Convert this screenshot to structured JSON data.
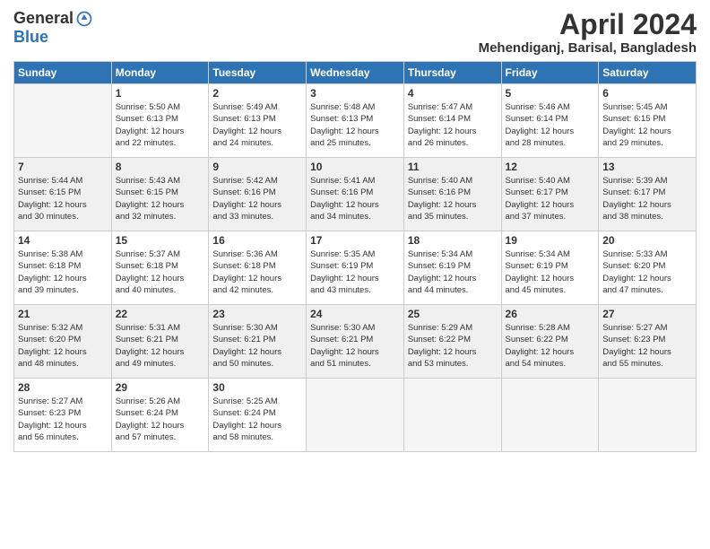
{
  "header": {
    "logo_general": "General",
    "logo_blue": "Blue",
    "month_title": "April 2024",
    "location": "Mehendiganj, Barisal, Bangladesh"
  },
  "days_of_week": [
    "Sunday",
    "Monday",
    "Tuesday",
    "Wednesday",
    "Thursday",
    "Friday",
    "Saturday"
  ],
  "weeks": [
    [
      {
        "day": "",
        "info": ""
      },
      {
        "day": "1",
        "info": "Sunrise: 5:50 AM\nSunset: 6:13 PM\nDaylight: 12 hours\nand 22 minutes."
      },
      {
        "day": "2",
        "info": "Sunrise: 5:49 AM\nSunset: 6:13 PM\nDaylight: 12 hours\nand 24 minutes."
      },
      {
        "day": "3",
        "info": "Sunrise: 5:48 AM\nSunset: 6:13 PM\nDaylight: 12 hours\nand 25 minutes."
      },
      {
        "day": "4",
        "info": "Sunrise: 5:47 AM\nSunset: 6:14 PM\nDaylight: 12 hours\nand 26 minutes."
      },
      {
        "day": "5",
        "info": "Sunrise: 5:46 AM\nSunset: 6:14 PM\nDaylight: 12 hours\nand 28 minutes."
      },
      {
        "day": "6",
        "info": "Sunrise: 5:45 AM\nSunset: 6:15 PM\nDaylight: 12 hours\nand 29 minutes."
      }
    ],
    [
      {
        "day": "7",
        "info": "Sunrise: 5:44 AM\nSunset: 6:15 PM\nDaylight: 12 hours\nand 30 minutes."
      },
      {
        "day": "8",
        "info": "Sunrise: 5:43 AM\nSunset: 6:15 PM\nDaylight: 12 hours\nand 32 minutes."
      },
      {
        "day": "9",
        "info": "Sunrise: 5:42 AM\nSunset: 6:16 PM\nDaylight: 12 hours\nand 33 minutes."
      },
      {
        "day": "10",
        "info": "Sunrise: 5:41 AM\nSunset: 6:16 PM\nDaylight: 12 hours\nand 34 minutes."
      },
      {
        "day": "11",
        "info": "Sunrise: 5:40 AM\nSunset: 6:16 PM\nDaylight: 12 hours\nand 35 minutes."
      },
      {
        "day": "12",
        "info": "Sunrise: 5:40 AM\nSunset: 6:17 PM\nDaylight: 12 hours\nand 37 minutes."
      },
      {
        "day": "13",
        "info": "Sunrise: 5:39 AM\nSunset: 6:17 PM\nDaylight: 12 hours\nand 38 minutes."
      }
    ],
    [
      {
        "day": "14",
        "info": "Sunrise: 5:38 AM\nSunset: 6:18 PM\nDaylight: 12 hours\nand 39 minutes."
      },
      {
        "day": "15",
        "info": "Sunrise: 5:37 AM\nSunset: 6:18 PM\nDaylight: 12 hours\nand 40 minutes."
      },
      {
        "day": "16",
        "info": "Sunrise: 5:36 AM\nSunset: 6:18 PM\nDaylight: 12 hours\nand 42 minutes."
      },
      {
        "day": "17",
        "info": "Sunrise: 5:35 AM\nSunset: 6:19 PM\nDaylight: 12 hours\nand 43 minutes."
      },
      {
        "day": "18",
        "info": "Sunrise: 5:34 AM\nSunset: 6:19 PM\nDaylight: 12 hours\nand 44 minutes."
      },
      {
        "day": "19",
        "info": "Sunrise: 5:34 AM\nSunset: 6:19 PM\nDaylight: 12 hours\nand 45 minutes."
      },
      {
        "day": "20",
        "info": "Sunrise: 5:33 AM\nSunset: 6:20 PM\nDaylight: 12 hours\nand 47 minutes."
      }
    ],
    [
      {
        "day": "21",
        "info": "Sunrise: 5:32 AM\nSunset: 6:20 PM\nDaylight: 12 hours\nand 48 minutes."
      },
      {
        "day": "22",
        "info": "Sunrise: 5:31 AM\nSunset: 6:21 PM\nDaylight: 12 hours\nand 49 minutes."
      },
      {
        "day": "23",
        "info": "Sunrise: 5:30 AM\nSunset: 6:21 PM\nDaylight: 12 hours\nand 50 minutes."
      },
      {
        "day": "24",
        "info": "Sunrise: 5:30 AM\nSunset: 6:21 PM\nDaylight: 12 hours\nand 51 minutes."
      },
      {
        "day": "25",
        "info": "Sunrise: 5:29 AM\nSunset: 6:22 PM\nDaylight: 12 hours\nand 53 minutes."
      },
      {
        "day": "26",
        "info": "Sunrise: 5:28 AM\nSunset: 6:22 PM\nDaylight: 12 hours\nand 54 minutes."
      },
      {
        "day": "27",
        "info": "Sunrise: 5:27 AM\nSunset: 6:23 PM\nDaylight: 12 hours\nand 55 minutes."
      }
    ],
    [
      {
        "day": "28",
        "info": "Sunrise: 5:27 AM\nSunset: 6:23 PM\nDaylight: 12 hours\nand 56 minutes."
      },
      {
        "day": "29",
        "info": "Sunrise: 5:26 AM\nSunset: 6:24 PM\nDaylight: 12 hours\nand 57 minutes."
      },
      {
        "day": "30",
        "info": "Sunrise: 5:25 AM\nSunset: 6:24 PM\nDaylight: 12 hours\nand 58 minutes."
      },
      {
        "day": "",
        "info": ""
      },
      {
        "day": "",
        "info": ""
      },
      {
        "day": "",
        "info": ""
      },
      {
        "day": "",
        "info": ""
      }
    ]
  ]
}
